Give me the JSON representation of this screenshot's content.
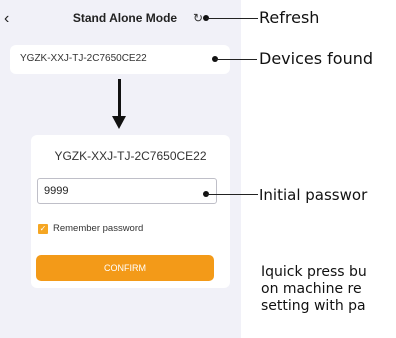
{
  "app": {
    "title": "Stand Alone Mode",
    "back_icon": "‹",
    "refresh_icon": "↻"
  },
  "devices": {
    "found_name": "YGZK-XXJ-TJ-2C7650CE22"
  },
  "login_card": {
    "device_name": "YGZK-XXJ-TJ-2C7650CE22",
    "password_value": "9999",
    "remember_label": "Remember password",
    "remember_checked": true,
    "confirm_label": "CONFIRM"
  },
  "annotations": {
    "refresh": "Refresh",
    "devices_found": "Devices found",
    "initial_password": "Initial passwor",
    "note_line1": "Iquick press bu",
    "note_line2": "on machine re",
    "note_line3": "setting with pa"
  },
  "colors": {
    "accent": "#f39a18",
    "checkbox": "#f5a623",
    "phone_bg": "#f1f1f8"
  }
}
